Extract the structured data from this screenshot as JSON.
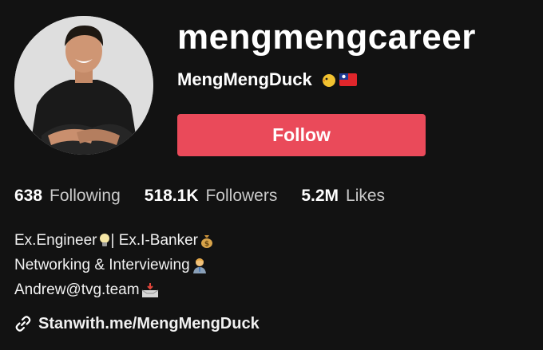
{
  "profile": {
    "username": "mengmengcareer",
    "nickname": "MengMengDuck",
    "nickname_emojis": [
      "chick-icon",
      "taiwan-flag-icon"
    ],
    "follow_label": "Follow",
    "follow_color": "#ea4a5a"
  },
  "stats": {
    "following_count": "638",
    "following_label": "Following",
    "followers_count": "518.1K",
    "followers_label": "Followers",
    "likes_count": "5.2M",
    "likes_label": "Likes"
  },
  "bio": {
    "line1_part1": "Ex.Engineer",
    "line1_part2": "| Ex.I-Banker",
    "line2": "Networking & Interviewing",
    "line3": "Andrew@tvg.team"
  },
  "link": {
    "text": "Stanwith.me/MengMengDuck",
    "icon": "link-icon"
  }
}
